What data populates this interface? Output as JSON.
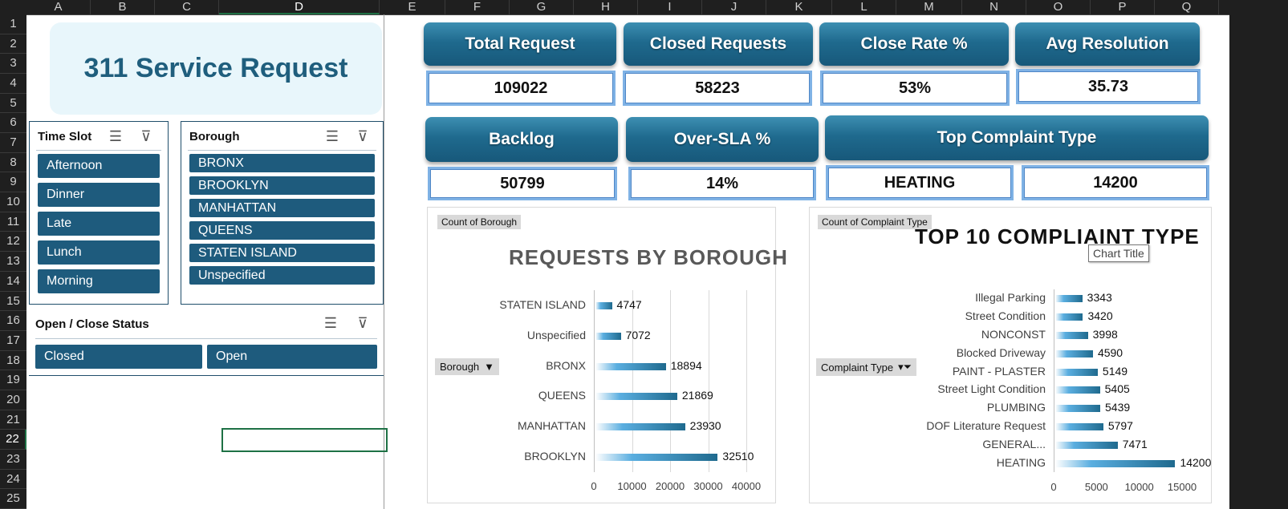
{
  "sheet": {
    "columns": [
      {
        "letter": "A",
        "w": 80
      },
      {
        "letter": "B",
        "w": 80
      },
      {
        "letter": "C",
        "w": 80
      },
      {
        "letter": "D",
        "w": 200
      },
      {
        "letter": "E",
        "w": 82
      },
      {
        "letter": "F",
        "w": 80
      },
      {
        "letter": "G",
        "w": 80
      },
      {
        "letter": "H",
        "w": 80
      },
      {
        "letter": "I",
        "w": 80
      },
      {
        "letter": "J",
        "w": 80
      },
      {
        "letter": "K",
        "w": 82
      },
      {
        "letter": "L",
        "w": 80
      },
      {
        "letter": "M",
        "w": 82
      },
      {
        "letter": "N",
        "w": 80
      },
      {
        "letter": "O",
        "w": 80
      },
      {
        "letter": "P",
        "w": 80
      },
      {
        "letter": "Q",
        "w": 80
      }
    ],
    "rows": [
      "1",
      "2",
      "3",
      "4",
      "5",
      "6",
      "7",
      "8",
      "9",
      "10",
      "11",
      "12",
      "13",
      "14",
      "15",
      "16",
      "17",
      "18",
      "19",
      "20",
      "21",
      "22",
      "23",
      "24",
      "25"
    ],
    "selected_column": "D",
    "selected_row": "22"
  },
  "title": "311 Service Request",
  "slicers": {
    "time_slot": {
      "title": "Time Slot",
      "items": [
        "Afternoon",
        "Dinner",
        "Late",
        "Lunch",
        "Morning"
      ]
    },
    "borough": {
      "title": "Borough",
      "items": [
        "BRONX",
        "BROOKLYN",
        "MANHATTAN",
        "QUEENS",
        "STATEN ISLAND",
        "Unspecified"
      ]
    },
    "status": {
      "title": "Open / Close Status",
      "items": [
        "Closed",
        "Open"
      ]
    },
    "icons": {
      "multi_select": "multi-select-icon",
      "clear_filter": "clear-filter-icon"
    }
  },
  "kpis": {
    "total_request": {
      "label": "Total Request",
      "value": "109022"
    },
    "closed_requests": {
      "label": "Closed Requests",
      "value": "58223"
    },
    "close_rate": {
      "label": "Close Rate %",
      "value": "53%"
    },
    "avg_resolution": {
      "label": "Avg Resolution",
      "value": "35.73"
    },
    "backlog": {
      "label": "Backlog",
      "value": "50799"
    },
    "over_sla": {
      "label": "Over-SLA %",
      "value": "14%"
    },
    "top_complaint": {
      "label": "Top Complaint Type",
      "value": "HEATING",
      "count": "14200"
    }
  },
  "colors": {
    "accent": "#1e5b7d",
    "kpi_border": "#7fb2e5",
    "title_text": "#1f5e7d"
  },
  "chart_data": [
    {
      "type": "bar",
      "orientation": "horizontal",
      "pivot_field": "Count of Borough",
      "title": "REQUESTS BY BOROUGH",
      "axis_field": "Borough",
      "categories": [
        "STATEN ISLAND",
        "Unspecified",
        "BRONX",
        "QUEENS",
        "MANHATTAN",
        "BROOKLYN"
      ],
      "values": [
        4747,
        7072,
        18894,
        21869,
        23930,
        32510
      ],
      "xlim": [
        0,
        40000
      ],
      "xticks": [
        "0",
        "10000",
        "20000",
        "30000",
        "40000"
      ],
      "grid": true
    },
    {
      "type": "bar",
      "orientation": "horizontal",
      "pivot_field": "Count of Complaint Type",
      "title": "TOP 10 COMPLIAINT TYPE",
      "title_tooltip": "Chart Title",
      "axis_field": "Complaint Type",
      "categories": [
        "Illegal Parking",
        "Street Condition",
        "NONCONST",
        "Blocked Driveway",
        "PAINT - PLASTER",
        "Street Light Condition",
        "PLUMBING",
        "DOF Literature Request",
        "GENERAL...",
        "HEATING"
      ],
      "values": [
        3343,
        3420,
        3998,
        4590,
        5149,
        5405,
        5439,
        5797,
        7471,
        14200
      ],
      "xlim": [
        0,
        15000
      ],
      "xticks": [
        "0",
        "5000",
        "10000",
        "15000"
      ],
      "grid": false
    }
  ]
}
